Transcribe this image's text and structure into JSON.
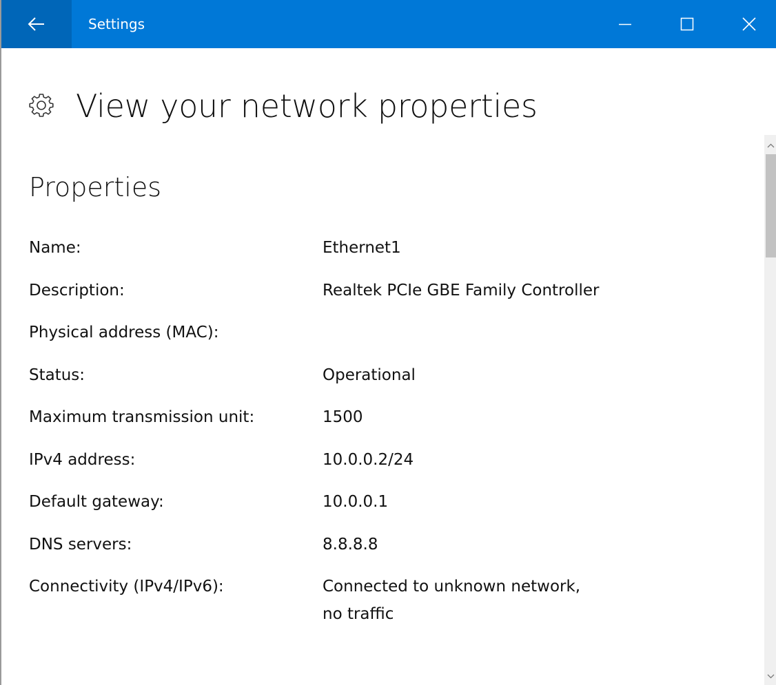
{
  "window": {
    "title": "Settings"
  },
  "titlebar_icons": {
    "back": "arrow-left-icon",
    "minimize": "minimize-icon",
    "maximize": "maximize-icon",
    "close": "close-icon"
  },
  "page": {
    "title": "View your network properties",
    "icon": "gear-icon"
  },
  "properties": {
    "heading": "Properties",
    "rows": [
      {
        "label": "Name:",
        "value": "Ethernet1"
      },
      {
        "label": "Description:",
        "value": "Realtek PCIe GBE Family Controller"
      },
      {
        "label": "Physical address (MAC):",
        "value": ""
      },
      {
        "label": "Status:",
        "value": "Operational"
      },
      {
        "label": "Maximum transmission unit:",
        "value": "1500"
      },
      {
        "label": "IPv4 address:",
        "value": "10.0.0.2/24"
      },
      {
        "label": "Default gateway:",
        "value": "10.0.0.1"
      },
      {
        "label": "DNS servers:",
        "value": "8.8.8.8"
      },
      {
        "label": "Connectivity (IPv4/IPv6):",
        "value": "Connected to unknown network,\nno traffic"
      }
    ]
  },
  "colors": {
    "titlebar": "#0078d7",
    "back_button": "#0066b8",
    "text": "#111111",
    "scroll_thumb": "#c2c2c2"
  }
}
